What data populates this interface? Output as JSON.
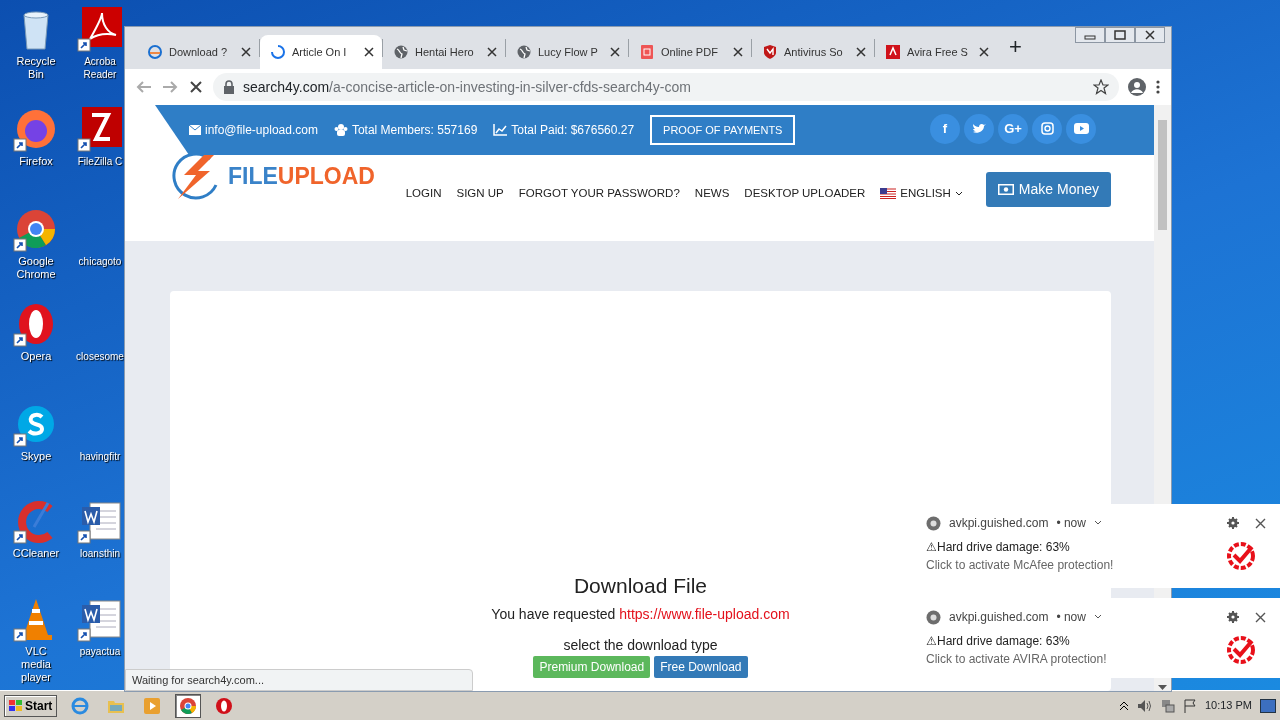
{
  "desktop_icons": [
    {
      "label": "Recycle Bin",
      "kind": "recycle"
    },
    {
      "label": "Firefox",
      "kind": "firefox"
    },
    {
      "label": "Google Chrome",
      "kind": "chrome"
    },
    {
      "label": "Opera",
      "kind": "opera"
    },
    {
      "label": "Skype",
      "kind": "skype"
    },
    {
      "label": "CCleaner",
      "kind": "ccleaner"
    },
    {
      "label": "VLC media player",
      "kind": "vlc"
    },
    {
      "label": "Acroba Reader",
      "kind": "acrobat"
    },
    {
      "label": "FileZilla C",
      "kind": "filezilla"
    },
    {
      "label": "chicagoto",
      "kind": "blank"
    },
    {
      "label": "closesome",
      "kind": "blank"
    },
    {
      "label": "havingfitr",
      "kind": "blank"
    },
    {
      "label": "loansthin",
      "kind": "word"
    },
    {
      "label": "payactua",
      "kind": "word"
    }
  ],
  "browser": {
    "tabs": [
      {
        "title": "Download ?",
        "kind": "ring",
        "selected": false
      },
      {
        "title": "Article On I",
        "kind": "spinner",
        "selected": true
      },
      {
        "title": "Hentai Hero",
        "kind": "globe",
        "selected": false
      },
      {
        "title": "Lucy Flow P",
        "kind": "globe",
        "selected": false
      },
      {
        "title": "Online PDF",
        "kind": "document",
        "selected": false
      },
      {
        "title": "Antivirus So",
        "kind": "shield",
        "selected": false
      },
      {
        "title": "Avira Free S",
        "kind": "square",
        "selected": false
      }
    ],
    "new_tab": "+",
    "address": {
      "host": "search4y.com",
      "path": "/a-concise-article-on-investing-in-silver-cfds-search4y-com"
    },
    "loading": true,
    "status": "Waiting for search4y.com..."
  },
  "site": {
    "topbar": {
      "email": "info@file-upload.com",
      "members": "Total Members: 557169",
      "paid": "Total Paid: $676560.27",
      "proof_button": "PROOF OF PAYMENTS",
      "socials": [
        {
          "kind": "glyph",
          "glyph": "f"
        },
        {
          "kind": "bird"
        },
        {
          "kind": "glyph",
          "glyph": "G+"
        },
        {
          "kind": "camera"
        },
        {
          "kind": "play"
        }
      ]
    },
    "logo": {
      "part_1": "FILE",
      "part_2": "UPLOAD"
    },
    "nav": [
      "LOGIN",
      "SIGN UP",
      "FORGOT YOUR PASSWORD?",
      "NEWS",
      "DESKTOP UPLOADER"
    ],
    "language": "ENGLISH",
    "make_money": "Make Money",
    "heading": "Download File",
    "requested": "You have requested ",
    "requested_link": "https://www.file-upload.com",
    "select_text": "select the download type",
    "buttons": [
      {
        "label": "Premium Download",
        "kind": "premium"
      },
      {
        "label": "Free Download",
        "kind": "free"
      }
    ]
  },
  "notifications": [
    {
      "source": "avkpi.guished.com",
      "time": "• now",
      "title": "⚠Hard drive damage: 63%",
      "body": "Click to activate McAfee protection!"
    },
    {
      "source": "avkpi.guished.com",
      "time": "• now",
      "title": "⚠Hard drive damage: 63%",
      "body": "Click to activate AVIRA protection!"
    }
  ],
  "taskbar": {
    "start": "Start",
    "apps": [
      {
        "kind": "ie",
        "selected": false
      },
      {
        "kind": "folder",
        "selected": false
      },
      {
        "kind": "media",
        "selected": false
      },
      {
        "kind": "chrome",
        "selected": true
      },
      {
        "kind": "opera",
        "selected": false
      }
    ],
    "time": "10:13 PM"
  }
}
